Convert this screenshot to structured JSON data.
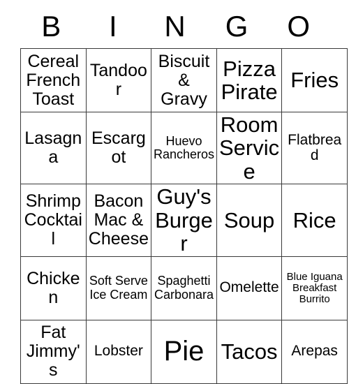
{
  "card": {
    "header": {
      "letters": [
        "B",
        "I",
        "N",
        "G",
        "O"
      ]
    },
    "rows": [
      [
        {
          "text": "Cereal French Toast",
          "size": "lg"
        },
        {
          "text": "Tandoor",
          "size": "lg"
        },
        {
          "text": "Biscuit & Gravy",
          "size": "lg"
        },
        {
          "text": "Pizza Pirate",
          "size": "xl"
        },
        {
          "text": "Fries",
          "size": "xl"
        }
      ],
      [
        {
          "text": "Lasagna",
          "size": "lg"
        },
        {
          "text": "Escargot",
          "size": "lg"
        },
        {
          "text": "Huevo Rancheros",
          "size": "sm"
        },
        {
          "text": "Room Service",
          "size": "xl"
        },
        {
          "text": "Flatbread",
          "size": "md"
        }
      ],
      [
        {
          "text": "Shrimp Cocktail",
          "size": "lg"
        },
        {
          "text": "Bacon Mac & Cheese",
          "size": "lg"
        },
        {
          "text": "Guy's Burger",
          "size": "xl"
        },
        {
          "text": "Soup",
          "size": "xl"
        },
        {
          "text": "Rice",
          "size": "xl"
        }
      ],
      [
        {
          "text": "Chicken",
          "size": "lg"
        },
        {
          "text": "Soft Serve Ice Cream",
          "size": "sm"
        },
        {
          "text": "Spaghetti Carbonara",
          "size": "sm"
        },
        {
          "text": "Omelette",
          "size": "md"
        },
        {
          "text": "Blue Iguana Breakfast Burrito",
          "size": "xs"
        }
      ],
      [
        {
          "text": "Fat Jimmy's",
          "size": "lg"
        },
        {
          "text": "Lobster",
          "size": "md"
        },
        {
          "text": "Pie",
          "size": "xxl"
        },
        {
          "text": "Tacos",
          "size": "xl"
        },
        {
          "text": "Arepas",
          "size": "md"
        }
      ]
    ]
  },
  "colors": {
    "background": "#ffffff",
    "text": "#000000",
    "grid_line": "#3a3a3a"
  }
}
